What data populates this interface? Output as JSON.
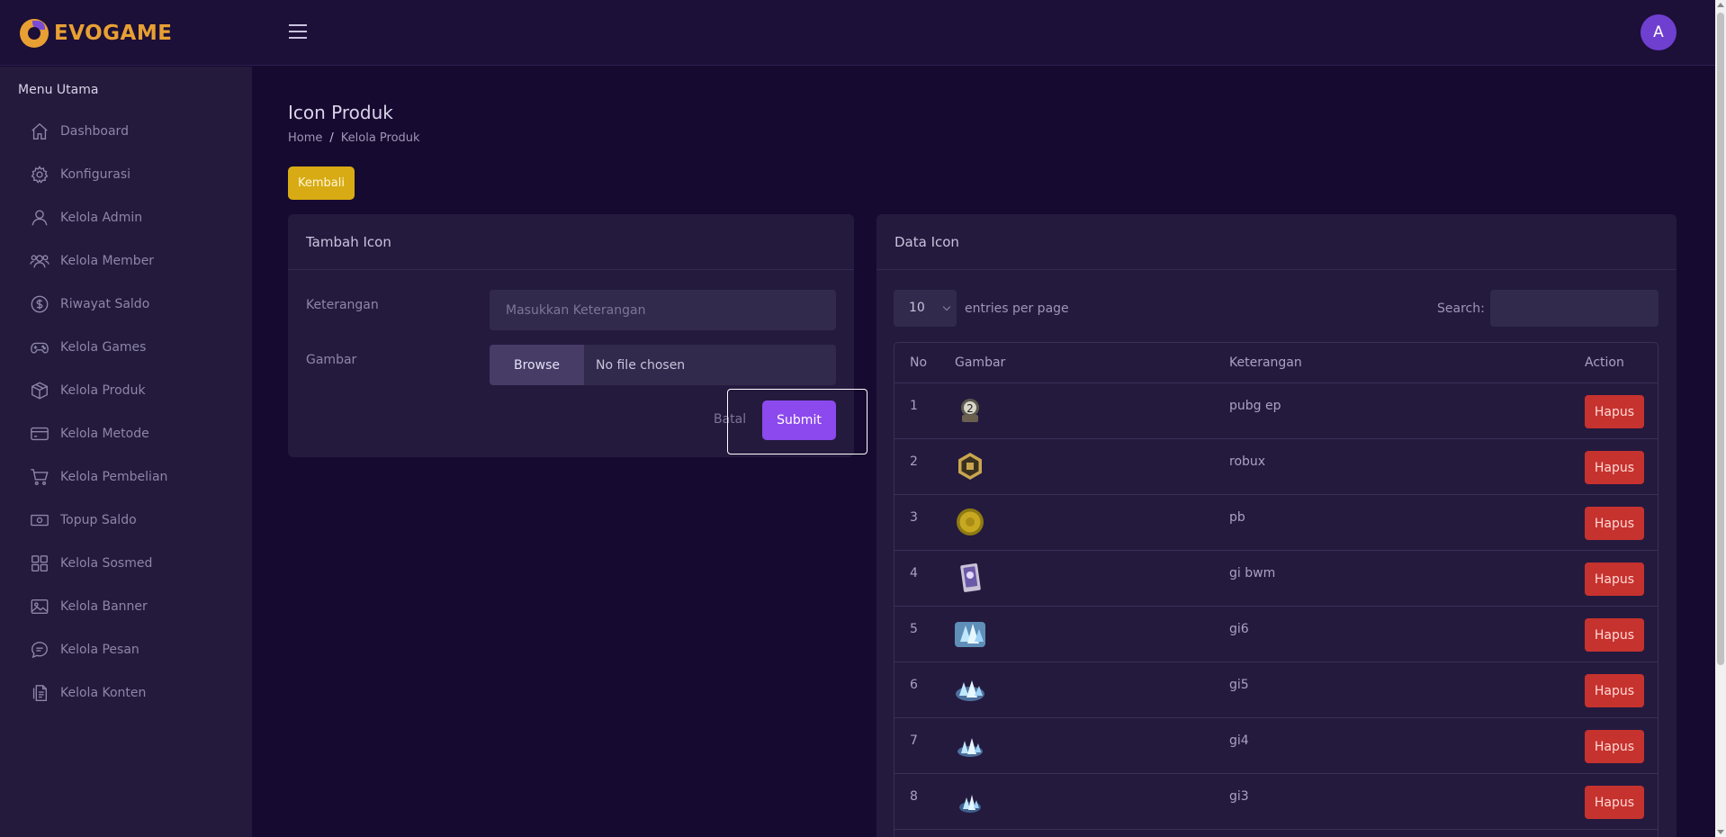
{
  "brand": {
    "name": "EVOGAME"
  },
  "user": {
    "avatar_letter": "A"
  },
  "sidebar": {
    "title": "Menu Utama",
    "items": [
      {
        "label": "Dashboard",
        "icon": "home-icon"
      },
      {
        "label": "Konfigurasi",
        "icon": "gear-icon"
      },
      {
        "label": "Kelola Admin",
        "icon": "user-icon"
      },
      {
        "label": "Kelola Member",
        "icon": "users-icon"
      },
      {
        "label": "Riwayat Saldo",
        "icon": "dollar-circle-icon"
      },
      {
        "label": "Kelola Games",
        "icon": "gamepad-icon"
      },
      {
        "label": "Kelola Produk",
        "icon": "box-icon"
      },
      {
        "label": "Kelola Metode",
        "icon": "credit-card-icon"
      },
      {
        "label": "Kelola Pembelian",
        "icon": "cart-icon"
      },
      {
        "label": "Topup Saldo",
        "icon": "cash-icon"
      },
      {
        "label": "Kelola Sosmed",
        "icon": "grid-icon"
      },
      {
        "label": "Kelola Banner",
        "icon": "image-icon"
      },
      {
        "label": "Kelola Pesan",
        "icon": "chat-icon"
      },
      {
        "label": "Kelola Konten",
        "icon": "document-icon"
      }
    ]
  },
  "page": {
    "title": "Icon Produk",
    "breadcrumb": {
      "home": "Home",
      "separator": "/",
      "current": "Kelola Produk"
    },
    "back_label": "Kembali"
  },
  "form": {
    "title": "Tambah Icon",
    "keterangan_label": "Keterangan",
    "keterangan_placeholder": "Masukkan Keterangan",
    "gambar_label": "Gambar",
    "browse_label": "Browse",
    "file_status": "No file chosen",
    "cancel_label": "Batal",
    "submit_label": "Submit"
  },
  "table": {
    "title": "Data Icon",
    "entries_value": "10",
    "entries_label": "entries per page",
    "search_label": "Search:",
    "columns": [
      "No",
      "Gambar",
      "Keterangan",
      "Action"
    ],
    "delete_label": "Hapus",
    "rows": [
      {
        "no": "1",
        "keterangan": "pubg ep",
        "icon": "pubg-ep-icon"
      },
      {
        "no": "2",
        "keterangan": "robux",
        "icon": "robux-icon"
      },
      {
        "no": "3",
        "keterangan": "pb",
        "icon": "pb-coin-icon"
      },
      {
        "no": "4",
        "keterangan": "gi bwm",
        "icon": "gi-bwm-icon"
      },
      {
        "no": "5",
        "keterangan": "gi6",
        "icon": "gi6-crystals-icon"
      },
      {
        "no": "6",
        "keterangan": "gi5",
        "icon": "gi5-crystals-icon"
      },
      {
        "no": "7",
        "keterangan": "gi4",
        "icon": "gi4-crystals-icon"
      },
      {
        "no": "8",
        "keterangan": "gi3",
        "icon": "gi3-crystals-icon"
      }
    ]
  },
  "colors": {
    "background": "#160a30",
    "sidebar": "#231a3c",
    "card": "#241a3e",
    "accent_purple": "#8c49ee",
    "back_button": "#d8ab14",
    "delete_button": "#c6322e",
    "brand_orange": "#e8a033"
  }
}
